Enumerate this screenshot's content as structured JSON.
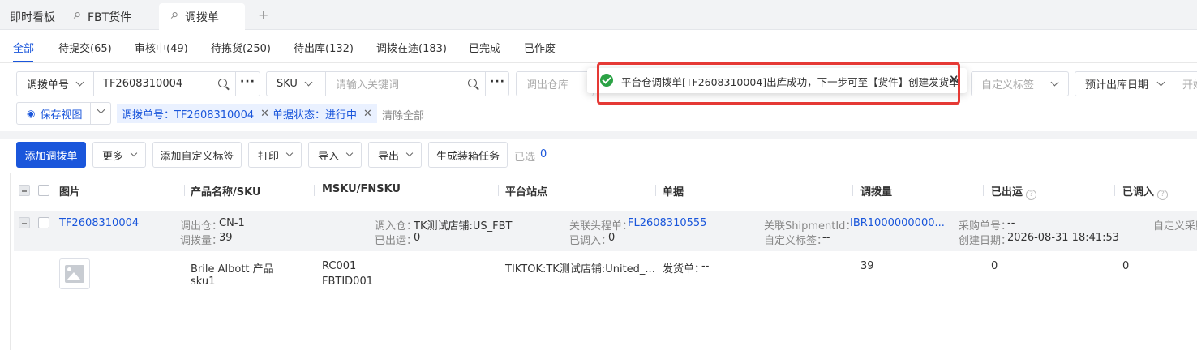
{
  "top_tabs": [
    {
      "label": "即时看板"
    },
    {
      "label": "FBT货件"
    },
    {
      "label": "调拨单"
    }
  ],
  "status_tabs": [
    "全部",
    "待提交(65)",
    "审核中(49)",
    "待拣货(250)",
    "待出库(132)",
    "调拨在途(183)",
    "已完成",
    "已作废"
  ],
  "filters": {
    "search_type": "调拨单号",
    "search_value": "TF2608310004",
    "sku_type": "SKU",
    "sku_placeholder": "请输入关键词",
    "warehouse_placeholder": "调出仓库",
    "custom_tag_placeholder": "自定义标签",
    "date_type": "预计出库日期",
    "date_start_placeholder": "开始"
  },
  "chips": {
    "save_view": "保存视图",
    "chip1": "调拨单号：TF2608310004",
    "chip2": "单据状态：进行中",
    "clear_all": "清除全部"
  },
  "toolbar": {
    "add": "添加调拨单",
    "more": "更多",
    "add_tag": "添加自定义标签",
    "print": "打印",
    "import": "导入",
    "export": "导出",
    "pack_task": "生成装箱任务",
    "selected_label": "已选",
    "selected_count": "0"
  },
  "table": {
    "headers": [
      "图片",
      "产品名称/SKU",
      "MSKU/FNSKU",
      "平台站点",
      "单据",
      "调拨量",
      "已出运",
      "已调入"
    ],
    "group": {
      "order_no": "TF2608310004",
      "out_wh_label": "调出仓：",
      "out_wh": "CN-1",
      "qty_label": "调拨量：",
      "qty": "39",
      "in_wh_label": "调入仓：",
      "in_wh": "TK测试店铺:US_FBT",
      "shipped_label": "已出运：",
      "shipped": "0",
      "lead_label": "关联头程单：",
      "lead": "FL2608310555",
      "received_label": "已调入：",
      "received": "0",
      "shipment_label": "关联ShipmentId：",
      "shipment": "IBR1000000000...",
      "custom_tag_label": "自定义标签：",
      "custom_tag": "--",
      "po_label": "采购单号：",
      "po": "--",
      "created_label": "创建日期：",
      "created": "2026-08-31 18:41:53",
      "custom_po_label": "自定义采购"
    },
    "row": {
      "product_name": "Brile Albott 产品",
      "sku": "sku1",
      "msku": "RC001",
      "fnsku": "FBTID001",
      "platform": "TIKTOK:TK测试店铺:United_...",
      "doc_label": "发货单：",
      "doc": "--",
      "qty": "39",
      "shipped": "0",
      "received": "0"
    }
  },
  "toast": {
    "message": "平台仓调拨单[TF2608310004]出库成功，下一步可至【货件】创建发货单"
  }
}
